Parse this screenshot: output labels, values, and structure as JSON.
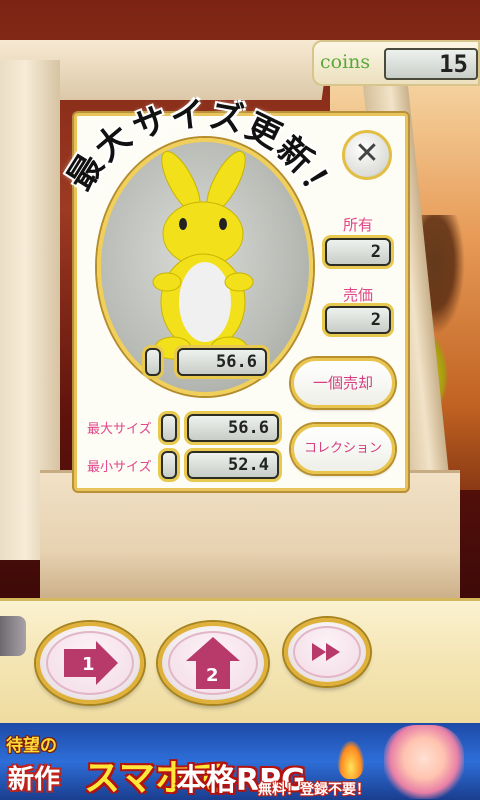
{
  "hud": {
    "coins_label": "coins",
    "coins_value": "15"
  },
  "popup": {
    "headline": [
      "最",
      "大",
      "サ",
      "イ",
      "ズ",
      "更",
      "新",
      "！"
    ],
    "prize_size": "56.6",
    "owned_label": "所有",
    "owned_value": "2",
    "price_label": "売価",
    "price_value": "2",
    "sell_one_button": "一個売却",
    "collection_button": "コレクション",
    "max_size_label": "最大サイズ",
    "max_size_value": "56.6",
    "min_size_label": "最小サイズ",
    "min_size_value": "52.4",
    "close_icon": "close-icon"
  },
  "controls": {
    "button1_label": "1",
    "button2_label": "2",
    "fast_forward_icon": "fast-forward-icon"
  },
  "ad": {
    "line1": "待望の",
    "line2": "新作",
    "line3": "スマホで",
    "line4": "本格RPG",
    "line5": "無料！登録不要！"
  },
  "colors": {
    "panel_border": "#e8c35a",
    "label_pink": "#e0478a",
    "coins_green": "#5aa83a",
    "mascot_yellow": "#f2e01a"
  }
}
